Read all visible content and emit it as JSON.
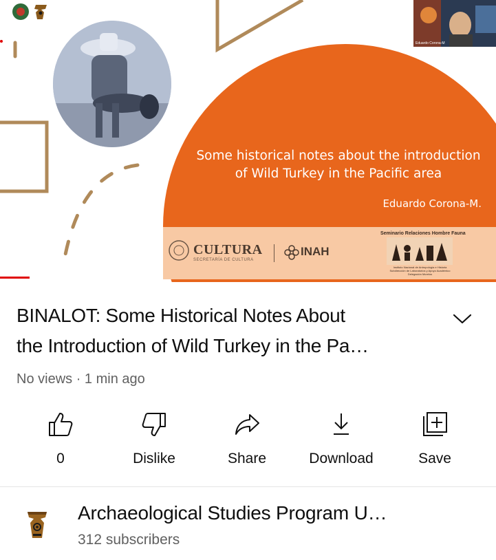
{
  "player": {
    "slide": {
      "title_line1": "Some historical notes about the introduction",
      "title_line2": "of Wild Turkey in the Pacific area",
      "author": "Eduardo Corona-M.",
      "logo_cultura": "CULTURA",
      "logo_cultura_sub": "SECRETARÍA DE CULTURA",
      "logo_inah": "INAH",
      "seminario": "Seminario Relaciones Hombre Fauna",
      "institution_lines": [
        "Instituto Nacional de Antropología e Historia",
        "Subdirección de Laboratorios y Apoyo Académico",
        "Delegación Morelos"
      ]
    },
    "webcam_name": "Eduardo Corona-M",
    "progress": 0.06,
    "progress_color": "#e00000"
  },
  "video": {
    "title_line1": "BINALOT: Some Historical Notes About",
    "title_line2": "the Introduction of Wild Turkey in the Pa…",
    "meta": "No views · 1 min ago",
    "expand_icon": "chevron-down-icon"
  },
  "actions": [
    {
      "icon": "thumbs-up-icon",
      "label": "0"
    },
    {
      "icon": "thumbs-down-icon",
      "label": "Dislike"
    },
    {
      "icon": "share-icon",
      "label": "Share"
    },
    {
      "icon": "download-icon",
      "label": "Download"
    },
    {
      "icon": "save-playlist-icon",
      "label": "Save"
    }
  ],
  "channel": {
    "name": "Archaeological Studies Program U…",
    "subscribers": "312 subscribers",
    "avatar_icon": "channel-logo-icon"
  },
  "colors": {
    "accent_orange": "#e8661c",
    "band_peach": "#f8c9a4",
    "deco_brown": "#b08a5a",
    "text_primary": "#0f0f0f",
    "text_secondary": "#606060"
  }
}
